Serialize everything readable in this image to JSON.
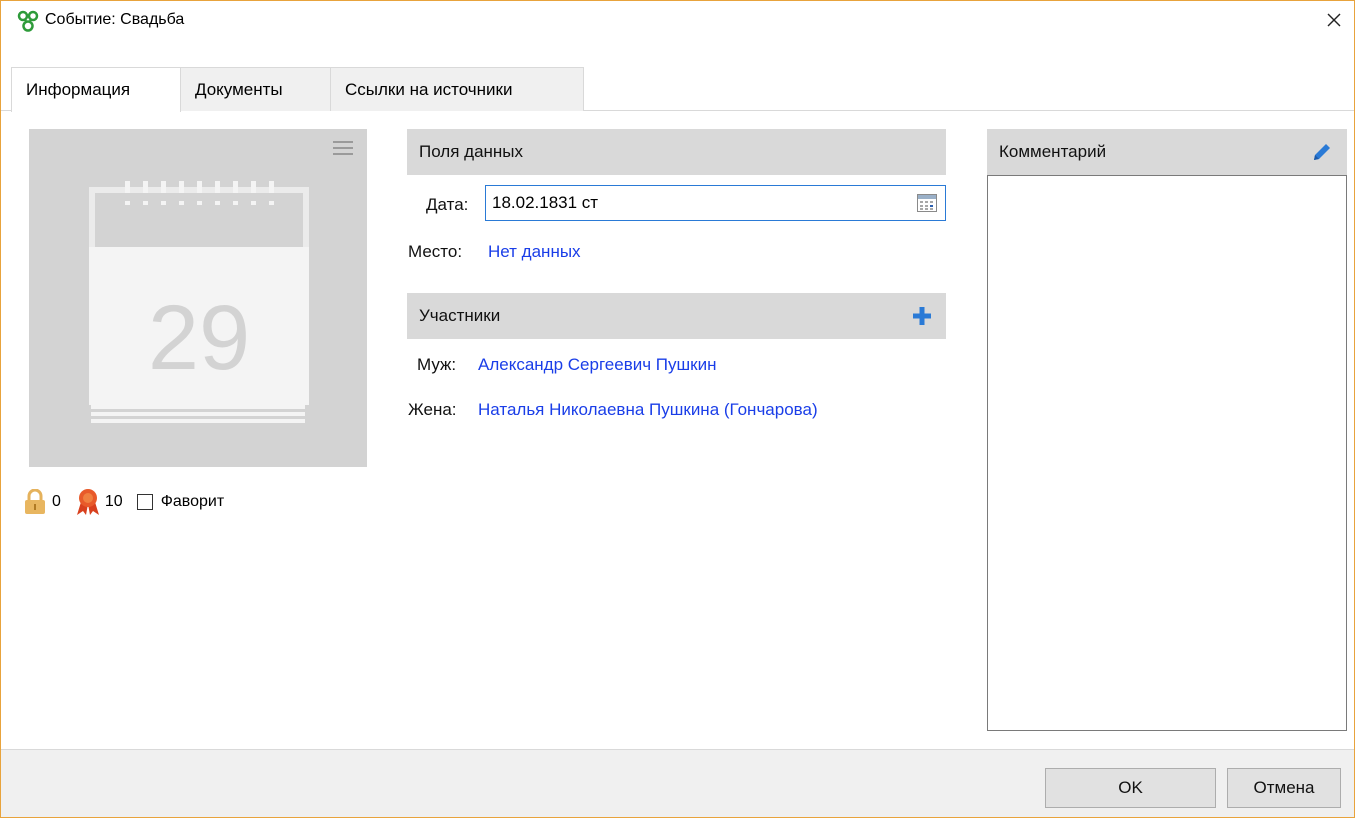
{
  "window": {
    "title": "Событие: Свадьба"
  },
  "tabs": [
    {
      "label": "Информация",
      "active": true
    },
    {
      "label": "Документы",
      "active": false
    },
    {
      "label": "Ссылки на источники",
      "active": false
    }
  ],
  "photo": {
    "day": "29",
    "icon": "calendar-icon"
  },
  "stats": {
    "lock_count": "0",
    "award_count": "10",
    "favorite_label": "Фаворит",
    "favorite_checked": false
  },
  "data_fields": {
    "header": "Поля данных",
    "date_label": "Дата:",
    "date_value": "18.02.1831 ст",
    "place_label": "Место:",
    "place_value": "Нет данных"
  },
  "participants": {
    "header": "Участники",
    "husband_label": "Муж:",
    "husband_value": "Александр Сергеевич Пушкин",
    "wife_label": "Жена:",
    "wife_value": "Наталья Николаевна Пушкина (Гончарова)"
  },
  "comment": {
    "header": "Комментарий",
    "text": ""
  },
  "buttons": {
    "ok": "OK",
    "cancel": "Отмена"
  },
  "colors": {
    "accent": "#2a7ad6",
    "link": "#1a3ee8",
    "window_border": "#e8a33c",
    "panel": "#d9d9d9"
  }
}
